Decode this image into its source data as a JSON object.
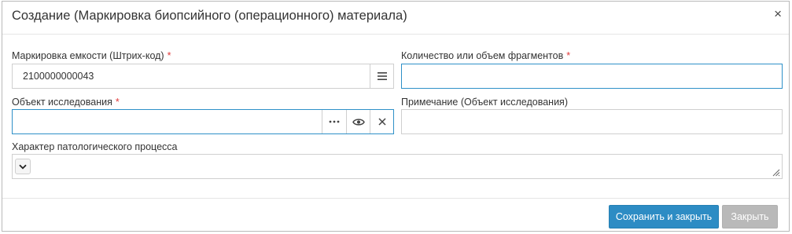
{
  "dialog": {
    "title": "Создание (Маркировка биопсийного (операционного) материала)",
    "close_symbol": "×"
  },
  "fields": {
    "container_marking": {
      "label": "Маркировка емкости (Штрих-код)",
      "required_mark": "*",
      "value": "2100000000043",
      "addon_icon": "list-menu-icon"
    },
    "fragments_count": {
      "label": "Количество или объем фрагментов",
      "required_mark": "*",
      "value": ""
    },
    "research_object": {
      "label": "Объект исследования",
      "required_mark": "*",
      "value": "",
      "addon_icons": [
        "ellipsis-icon",
        "eye-icon",
        "clear-icon"
      ]
    },
    "research_object_note": {
      "label": "Примечание (Объект исследования)",
      "value": ""
    },
    "pathological_process": {
      "label": "Характер патологического процесса",
      "value": ""
    }
  },
  "footer": {
    "save_close_label": "Сохранить и закрыть",
    "close_label": "Закрыть"
  },
  "colors": {
    "primary": "#2d8cc4",
    "focus_border": "#2e90c8",
    "disabled": "#b9b9b9",
    "required": "#e03a3a"
  }
}
